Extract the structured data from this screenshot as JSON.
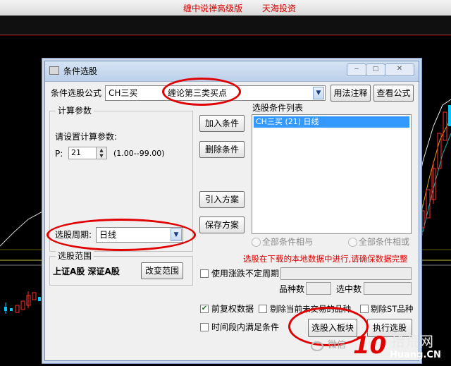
{
  "window": {
    "title_left": "缠中说禅高级版",
    "title_right": "天海投资"
  },
  "dialog": {
    "title": "条件选股",
    "formula_label": "条件选股公式",
    "formula_code": "CH三买",
    "formula_name": "缠论第三类买点",
    "usage_button": "用法注释",
    "view_formula_button": "查看公式",
    "calc_group_label": "计算参数",
    "param_prompt": "请设置计算参数:",
    "param_name": "P:",
    "param_value": "21",
    "param_range": "(1.00--99.00)",
    "add_condition_button": "加入条件",
    "delete_condition_button": "删除条件",
    "import_plan_button": "引入方案",
    "save_plan_button": "保存方案",
    "condition_list_label": "选股条件列表",
    "condition_items": [
      "CH三买 (21) 日线"
    ],
    "period_label": "选股周期:",
    "period_value": "日线",
    "range_group_label": "选股范围",
    "range_text": "上证A股 深证A股",
    "change_range_button": "改变范围",
    "all_and_label": "全部条件相与",
    "all_or_label": "全部条件相或",
    "warning": "选股在下载的本地数据中进行,请确保数据完整",
    "variable_period_label": "使用涨跌不定周期",
    "stock_count_label": "品种数",
    "selected_count_label": "选中数",
    "forward_adjust_label": "前复权数据",
    "exclude_suspended_label": "剔除当前未交易的品种",
    "exclude_st_label": "剔除ST品种",
    "time_range_label": "时间段内满足条件",
    "add_to_block_button": "选股入板块",
    "execute_button": "执行选股",
    "checks": {
      "variable_period": false,
      "forward_adjust": true,
      "exclude_suspended": false,
      "exclude_st": false,
      "time_range": false
    }
  },
  "watermark": {
    "wechat": "微信",
    "logo_number": "10",
    "site_cn": "拾荒网",
    "site_en": "Huang.CN"
  },
  "colors": {
    "highlight_ellipse": "#e00000",
    "list_selection": "#3399ff",
    "warning_text": "#e00000",
    "title_text": "#d40000"
  }
}
